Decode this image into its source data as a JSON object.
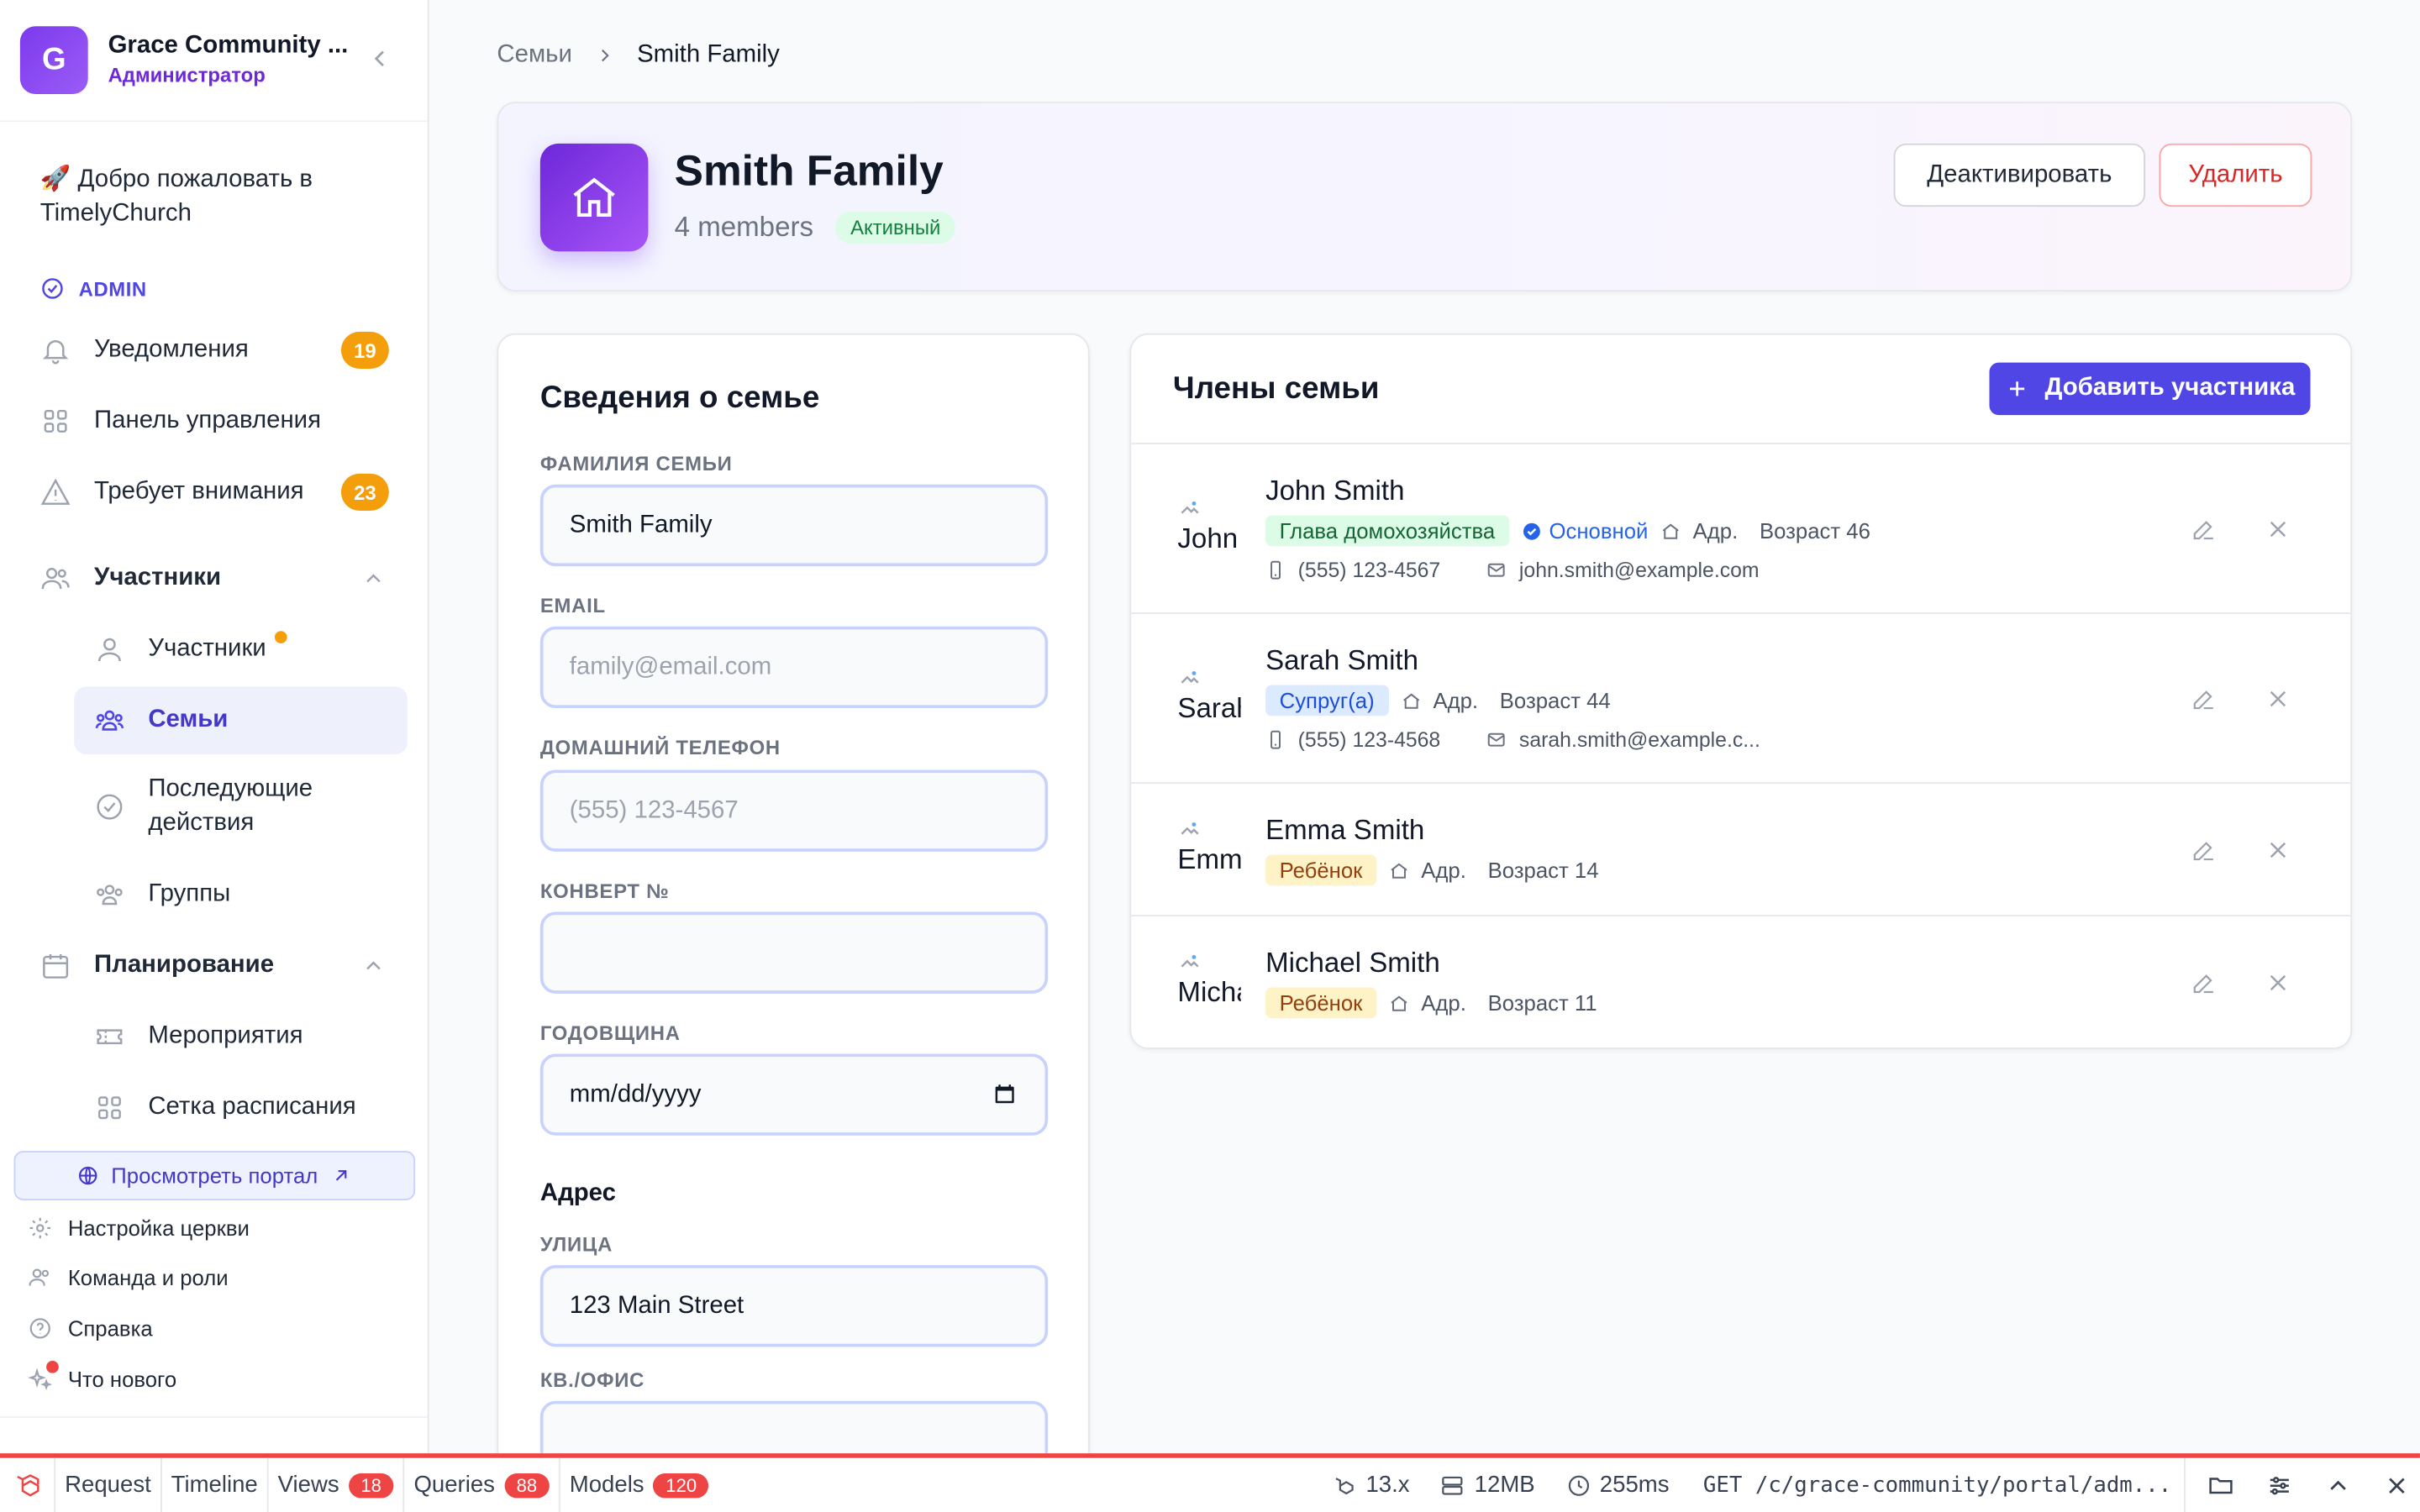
{
  "org": {
    "logo_letter": "G",
    "name": "Grace Community ...",
    "role": "Администратор"
  },
  "sidebar": {
    "welcome": "🚀 Добро пожаловать в TimelyChurch",
    "admin_label": "ADMIN",
    "notifications": {
      "label": "Уведомления",
      "badge": "19"
    },
    "dashboard": {
      "label": "Панель управления"
    },
    "attention": {
      "label": "Требует внимания",
      "badge": "23"
    },
    "members_group": {
      "label": "Участники"
    },
    "members_items": [
      {
        "label": "Участники"
      },
      {
        "label": "Семьи"
      },
      {
        "label": "Последующие действия"
      },
      {
        "label": "Группы"
      }
    ],
    "planning_group": {
      "label": "Планирование"
    },
    "planning_items": [
      {
        "label": "Мероприятия"
      },
      {
        "label": "Сетка расписания"
      }
    ],
    "portal_button": "Просмотреть портал",
    "footer_items": [
      {
        "label": "Настройка церкви"
      },
      {
        "label": "Команда и роли"
      },
      {
        "label": "Справка"
      },
      {
        "label": "Что нового"
      }
    ]
  },
  "breadcrumb": {
    "parent": "Семьи",
    "current": "Smith Family"
  },
  "hero": {
    "title": "Smith Family",
    "members_count": "4 members",
    "status": "Активный",
    "deactivate_label": "Деактивировать",
    "delete_label": "Удалить"
  },
  "details": {
    "title": "Сведения о семье",
    "family_name_label": "ФАМИЛИЯ СЕМЬИ",
    "family_name_value": "Smith Family",
    "email_label": "EMAIL",
    "email_placeholder": "family@email.com",
    "phone_label": "ДОМАШНИЙ ТЕЛЕФОН",
    "phone_placeholder": "(555) 123-4567",
    "envelope_label": "КОНВЕРТ №",
    "envelope_value": "",
    "anniversary_label": "ГОДОВЩИНА",
    "anniversary_value": "mm/dd/yyyy",
    "address_heading": "Адрес",
    "street_label": "УЛИЦА",
    "street_value": "123 Main Street",
    "unit_label": "КВ./ОФИС",
    "unit_value": ""
  },
  "members": {
    "title": "Члены семьи",
    "add_label": "Добавить участника",
    "address_short": "Адр.",
    "primary_label": "Основной",
    "list": [
      {
        "name": "John Smith",
        "alt": "John",
        "role": "Глава домохозяйства",
        "age": "Возраст 46",
        "phone": "(555) 123-4567",
        "email": "john.smith@example.com"
      },
      {
        "name": "Sarah Smith",
        "alt": "Sarah",
        "role": "Супруг(а)",
        "age": "Возраст 44",
        "phone": "(555) 123-4568",
        "email": "sarah.smith@example.c..."
      },
      {
        "name": "Emma Smith",
        "alt": "Emma",
        "role": "Ребёнок",
        "age": "Возраст 14"
      },
      {
        "name": "Michael Smith",
        "alt": "Michael",
        "role": "Ребёнок",
        "age": "Возраст 11"
      }
    ]
  },
  "debugbar": {
    "tabs": [
      {
        "label": "Request"
      },
      {
        "label": "Timeline"
      },
      {
        "label": "Views",
        "badge": "18"
      },
      {
        "label": "Queries",
        "badge": "88"
      },
      {
        "label": "Models",
        "badge": "120"
      }
    ],
    "version": "13.x",
    "memory": "12MB",
    "time": "255ms",
    "route": "GET /c/grace-community/portal/adm..."
  },
  "colors": {
    "accent": "#4f46e5",
    "badge": "#f59e0b",
    "danger": "#dc2626",
    "debug": "#ef4444"
  }
}
